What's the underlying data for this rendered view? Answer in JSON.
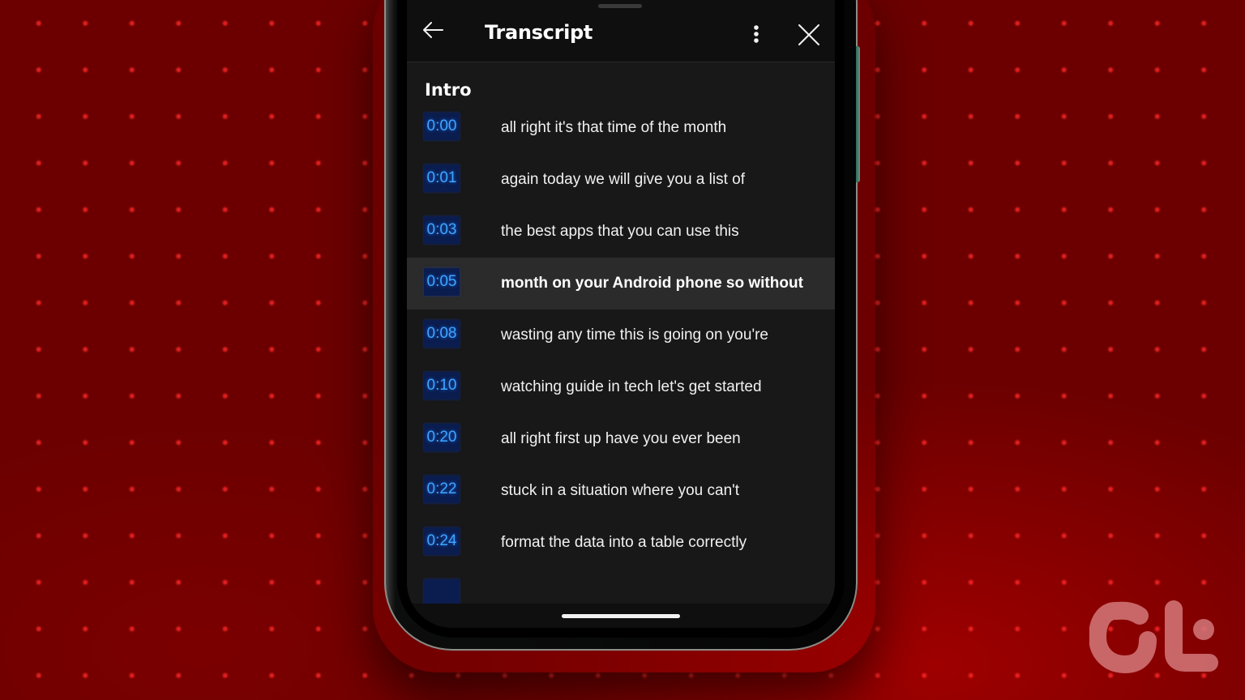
{
  "header": {
    "title": "Transcript",
    "back_icon": "arrow-left-icon",
    "more_icon": "more-vertical-icon",
    "close_icon": "close-icon"
  },
  "section": {
    "title": "Intro"
  },
  "transcript": [
    {
      "time": "0:00",
      "text": "all right it's that time of the month",
      "active": false
    },
    {
      "time": "0:01",
      "text": "again today we will give you a list of",
      "active": false
    },
    {
      "time": "0:03",
      "text": "the best apps that you can use this",
      "active": false
    },
    {
      "time": "0:05",
      "text": "month on your Android phone so without",
      "active": true
    },
    {
      "time": "0:08",
      "text": "wasting any time this is going on you're",
      "active": false
    },
    {
      "time": "0:10",
      "text": "watching guide in tech let's get started",
      "active": false
    },
    {
      "time": "0:20",
      "text": "all right first up have you ever been",
      "active": false
    },
    {
      "time": "0:22",
      "text": "stuck in a situation where you can't",
      "active": false
    },
    {
      "time": "0:24",
      "text": "format the data into a table correctly",
      "active": false
    }
  ],
  "colors": {
    "background": "#6c0000",
    "screen": "#181818",
    "header": "#0f0f0f",
    "active_row": "#2b2b2b",
    "timestamp_bg": "#0b1d4e",
    "timestamp_text": "#3ea6ff",
    "logo": "#d4787a"
  },
  "watermark": {
    "logo_icon": "guiding-tech-logo-icon"
  }
}
